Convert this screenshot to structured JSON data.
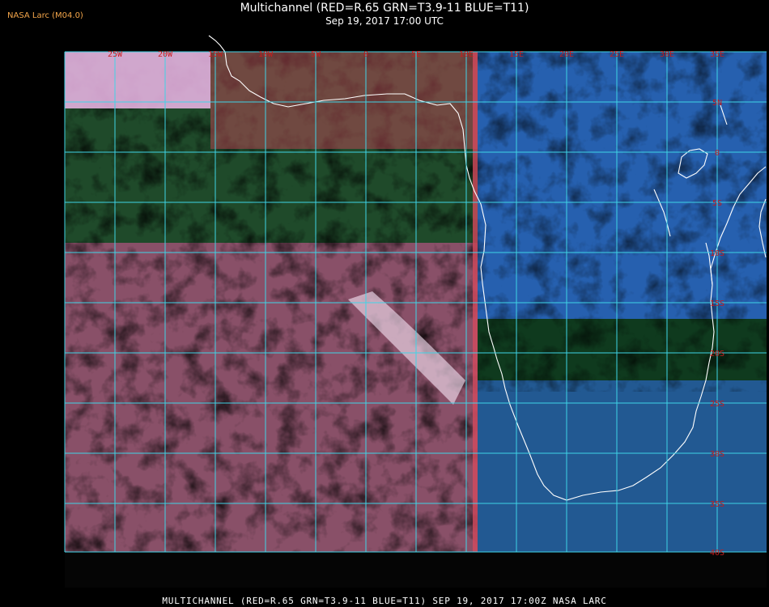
{
  "header": {
    "badge": "NASA Larc (M04.0)",
    "title": "Multichannel (RED=R.65 GRN=T3.9-11 BLUE=T11)",
    "subtitle": "Sep 19, 2017 17:00 UTC"
  },
  "footer": {
    "caption": "MULTICHANNEL (RED=R.65 GRN=T3.9-11 BLUE=T11) SEP 19, 2017 17:00Z   NASA LARC"
  },
  "map": {
    "colors": {
      "grid": "#3fd4e6",
      "label": "#c81c1c",
      "coast": "#ffffff",
      "ocean_left": "#1f4a2a",
      "ocean_right": "#0f3a1e",
      "cloud_pink": "#e0559b",
      "cloud_red": "#d34a5e",
      "cloud_blue": "#2f6ee0",
      "cloud_cyan": "#6fc4ee"
    },
    "lon_labels": [
      "25W",
      "20W",
      "15W",
      "10W",
      "5W",
      "0",
      "5E",
      "10E",
      "15E",
      "20E",
      "25E",
      "30E",
      "35E"
    ],
    "lat_labels": [
      "5N",
      "0",
      "5S",
      "10S",
      "15S",
      "20S",
      "25S",
      "30S",
      "35S",
      "40S"
    ]
  }
}
